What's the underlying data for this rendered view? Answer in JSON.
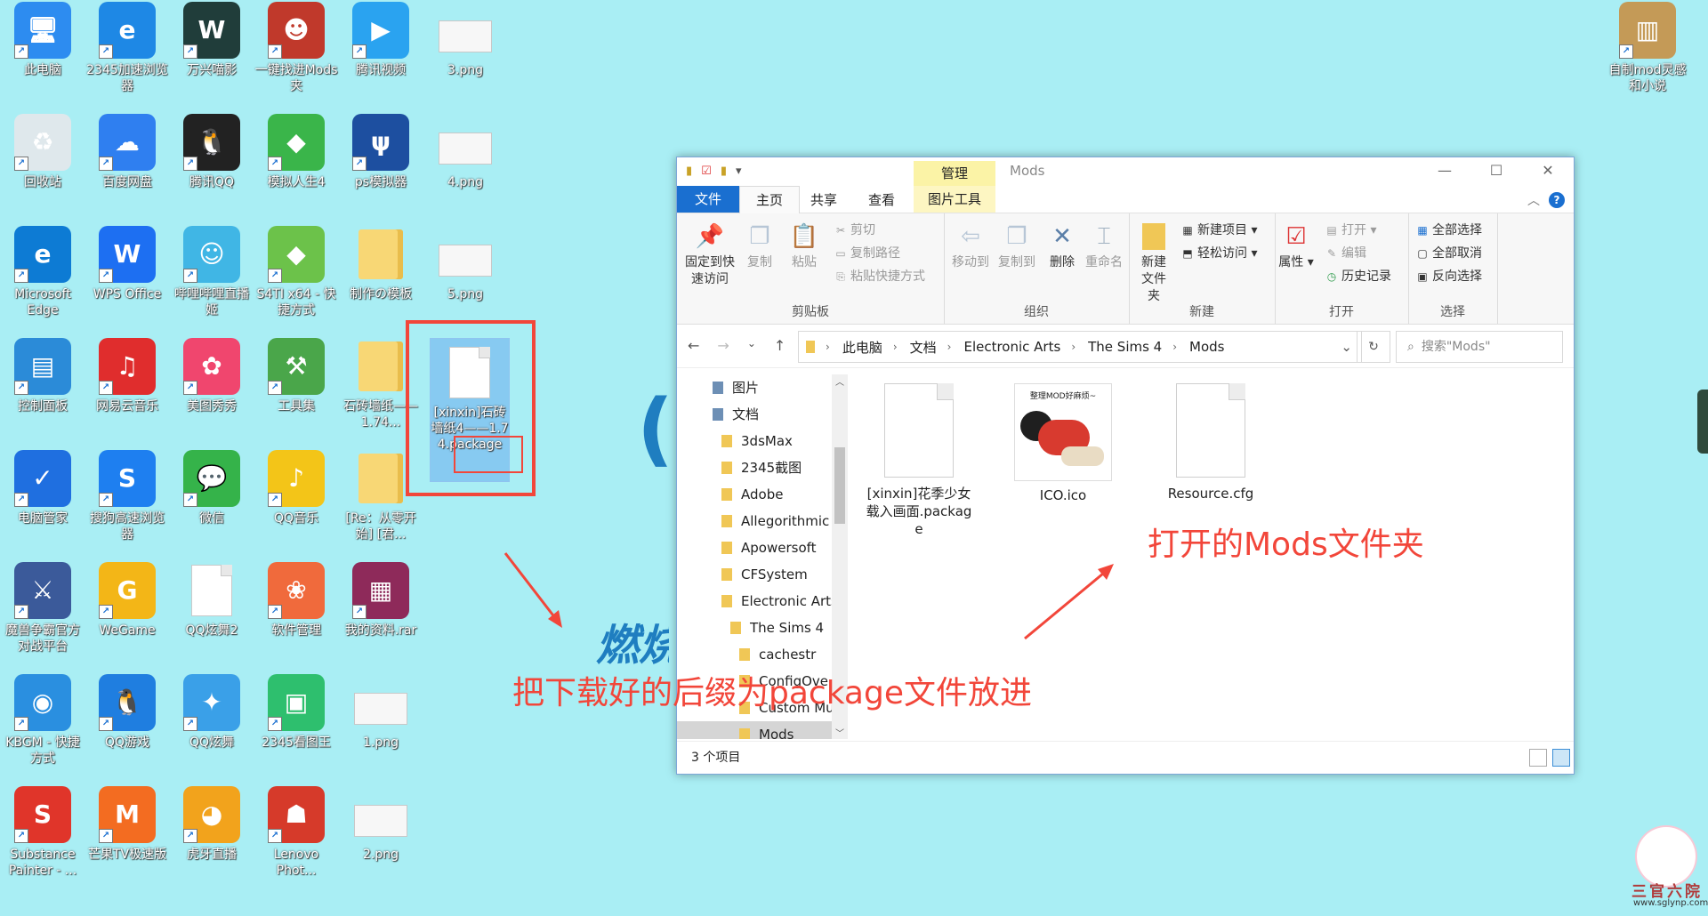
{
  "desktop": {
    "icons": [
      {
        "label": "此电脑",
        "icon": "computer-icon",
        "color": "#2d8cf0"
      },
      {
        "label": "2345加速浏览器",
        "icon": "browser-e-icon",
        "color": "#1e88e5"
      },
      {
        "label": "万兴喵影",
        "icon": "filmora-icon",
        "color": "#203d3a"
      },
      {
        "label": "一键找进Mods夹",
        "icon": "character-icon",
        "color": "#c0392b"
      },
      {
        "label": "腾讯视频",
        "icon": "play-icon",
        "color": "#2aa3f0"
      },
      {
        "label": "3.png",
        "icon": "image-file-icon",
        "color": "#f7f7f7"
      },
      {
        "label": "回收站",
        "icon": "recycle-bin-icon",
        "color": "#dfe8ec"
      },
      {
        "label": "百度网盘",
        "icon": "cloud-icon",
        "color": "#2f7ff0"
      },
      {
        "label": "腾讯QQ",
        "icon": "qq-penguin-icon",
        "color": "#222222"
      },
      {
        "label": "模拟人生4",
        "icon": "plumbob-icon",
        "color": "#3ab54a"
      },
      {
        "label": "ps模拟器",
        "icon": "ps-icon",
        "color": "#1d4fa0"
      },
      {
        "label": "4.png",
        "icon": "image-file-icon",
        "color": "#f7f7f7"
      },
      {
        "label": "Microsoft Edge",
        "icon": "edge-icon",
        "color": "#0d7bd4"
      },
      {
        "label": "WPS Office",
        "icon": "wps-icon",
        "color": "#1d6ff2"
      },
      {
        "label": "哔哩哔哩直播姬",
        "icon": "bilibili-icon",
        "color": "#40b6e5"
      },
      {
        "label": "S4TI x64 - 快捷方式",
        "icon": "plumbob-icon",
        "color": "#6cc24a"
      },
      {
        "label": "制作の模板",
        "icon": "folder-icon",
        "color": "#f8d775"
      },
      {
        "label": "5.png",
        "icon": "image-file-icon",
        "color": "#f7f7f7"
      },
      {
        "label": "控制面板",
        "icon": "control-panel-icon",
        "color": "#2b8bd8"
      },
      {
        "label": "网易云音乐",
        "icon": "music-icon",
        "color": "#e02d2d"
      },
      {
        "label": "美图秀秀",
        "icon": "meitu-icon",
        "color": "#f0466e"
      },
      {
        "label": "工具集",
        "icon": "tools-icon",
        "color": "#4aa64a"
      },
      {
        "label": "石砖墙纸——1.74...",
        "icon": "folder-icon",
        "color": "#f8d775"
      },
      {
        "label": "[xinxin]石砖墙纸4——1.74.package",
        "icon": "package-file-icon",
        "color": "#ffffff"
      },
      {
        "label": "电脑管家",
        "icon": "shield-icon",
        "color": "#1f6fe0"
      },
      {
        "label": "搜狗高速浏览器",
        "icon": "sogou-icon",
        "color": "#1e7ff0"
      },
      {
        "label": "微信",
        "icon": "wechat-icon",
        "color": "#35b34a"
      },
      {
        "label": "QQ音乐",
        "icon": "qq-music-icon",
        "color": "#f3c518"
      },
      {
        "label": "[Re：从零开始] [君...",
        "icon": "folder-icon",
        "color": "#f8d775"
      },
      {
        "label": "魔兽争霸官方对战平台",
        "icon": "warcraft-icon",
        "color": "#3b5a9a"
      },
      {
        "label": "WeGame",
        "icon": "wegame-icon",
        "color": "#f3b617"
      },
      {
        "label": "QQ炫舞2",
        "icon": "file-icon",
        "color": "#ffffff"
      },
      {
        "label": "软件管理",
        "icon": "flower-icon",
        "color": "#f06a3c"
      },
      {
        "label": "我的资料.rar",
        "icon": "winrar-icon",
        "color": "#8e2a5a"
      },
      {
        "label": "KBGM - 快捷方式",
        "icon": "kbgm-icon",
        "color": "#2a8fe0"
      },
      {
        "label": "QQ游戏",
        "icon": "qq-game-icon",
        "color": "#1f7ee0"
      },
      {
        "label": "QQ炫舞",
        "icon": "qq-dance-icon",
        "color": "#3aa0e8"
      },
      {
        "label": "2345看图王",
        "icon": "picture-viewer-icon",
        "color": "#2ebf6e"
      },
      {
        "label": "1.png",
        "icon": "image-file-icon",
        "color": "#f7f7f7"
      },
      {
        "label": "Substance Painter - ...",
        "icon": "substance-icon",
        "color": "#e0352a"
      },
      {
        "label": "芒果TV极速版",
        "icon": "mango-tv-icon",
        "color": "#f36c21"
      },
      {
        "label": "虎牙直播",
        "icon": "huya-icon",
        "color": "#f2a31c"
      },
      {
        "label": "Lenovo Phot...",
        "icon": "lenovo-photo-icon",
        "color": "#d63a2a"
      },
      {
        "label": "2.png",
        "icon": "image-file-icon",
        "color": "#f7f7f7"
      },
      {
        "label": "自制mod灵感和小说",
        "icon": "book-icon",
        "color": "#c49a57"
      }
    ]
  },
  "explorer": {
    "title": "Mods",
    "manage_tab": "管理",
    "tabs": {
      "file": "文件",
      "home": "主页",
      "share": "共享",
      "view": "查看",
      "picture_tools": "图片工具"
    },
    "ribbon": {
      "clipboard": {
        "label": "剪贴板",
        "pin": "固定到快速访问",
        "copy": "复制",
        "paste": "粘贴",
        "cut": "剪切",
        "copy_path": "复制路径",
        "paste_shortcut": "粘贴快捷方式"
      },
      "organize": {
        "label": "组织",
        "move_to": "移动到",
        "copy_to": "复制到",
        "delete": "删除",
        "rename": "重命名"
      },
      "new": {
        "label": "新建",
        "new_folder": "新建文件夹",
        "new_item": "新建项目",
        "easy_access": "轻松访问"
      },
      "open": {
        "label": "打开",
        "properties": "属性",
        "open": "打开",
        "edit": "编辑",
        "history": "历史记录"
      },
      "select": {
        "label": "选择",
        "select_all": "全部选择",
        "select_none": "全部取消",
        "invert": "反向选择"
      }
    },
    "breadcrumb": [
      "此电脑",
      "文档",
      "Electronic Arts",
      "The Sims 4",
      "Mods"
    ],
    "search_placeholder": "搜索\"Mods\"",
    "nav_items": [
      {
        "label": "图片",
        "level": 0
      },
      {
        "label": "文档",
        "level": 0
      },
      {
        "label": "3dsMax",
        "level": 1
      },
      {
        "label": "2345截图",
        "level": 1
      },
      {
        "label": "Adobe",
        "level": 1
      },
      {
        "label": "Allegorithmic",
        "level": 1
      },
      {
        "label": "Apowersoft",
        "level": 1
      },
      {
        "label": "CFSystem",
        "level": 1
      },
      {
        "label": "Electronic Arts",
        "level": 1
      },
      {
        "label": "The Sims 4",
        "level": 2
      },
      {
        "label": "cachestr",
        "level": 3
      },
      {
        "label": "ConfigOve",
        "level": 3
      },
      {
        "label": "Custom Mu",
        "level": 3
      },
      {
        "label": "Mods",
        "level": 3,
        "active": true
      }
    ],
    "files": [
      {
        "name": "[xinxin]花季少女载入画面.package",
        "type": "package"
      },
      {
        "name": "ICO.ico",
        "type": "ico",
        "thumb_text": "整理MOD好麻烦~"
      },
      {
        "name": "Resource.cfg",
        "type": "cfg"
      }
    ],
    "status": "3 个项目"
  },
  "annotations": {
    "put_text": "把下载好的后缀为package文件放进",
    "opened_text": "打开的Mods文件夹",
    "blue_fragment": "燃烧",
    "blue_paren": "("
  },
  "watermark": {
    "text": "三官六院",
    "url": "www.sglynp.com"
  },
  "colors": {
    "desktop_bg": "#a9eef4",
    "accent": "#1a6fd0",
    "annotation_red": "#f2463a",
    "manage_tab": "#fbf3a6"
  }
}
